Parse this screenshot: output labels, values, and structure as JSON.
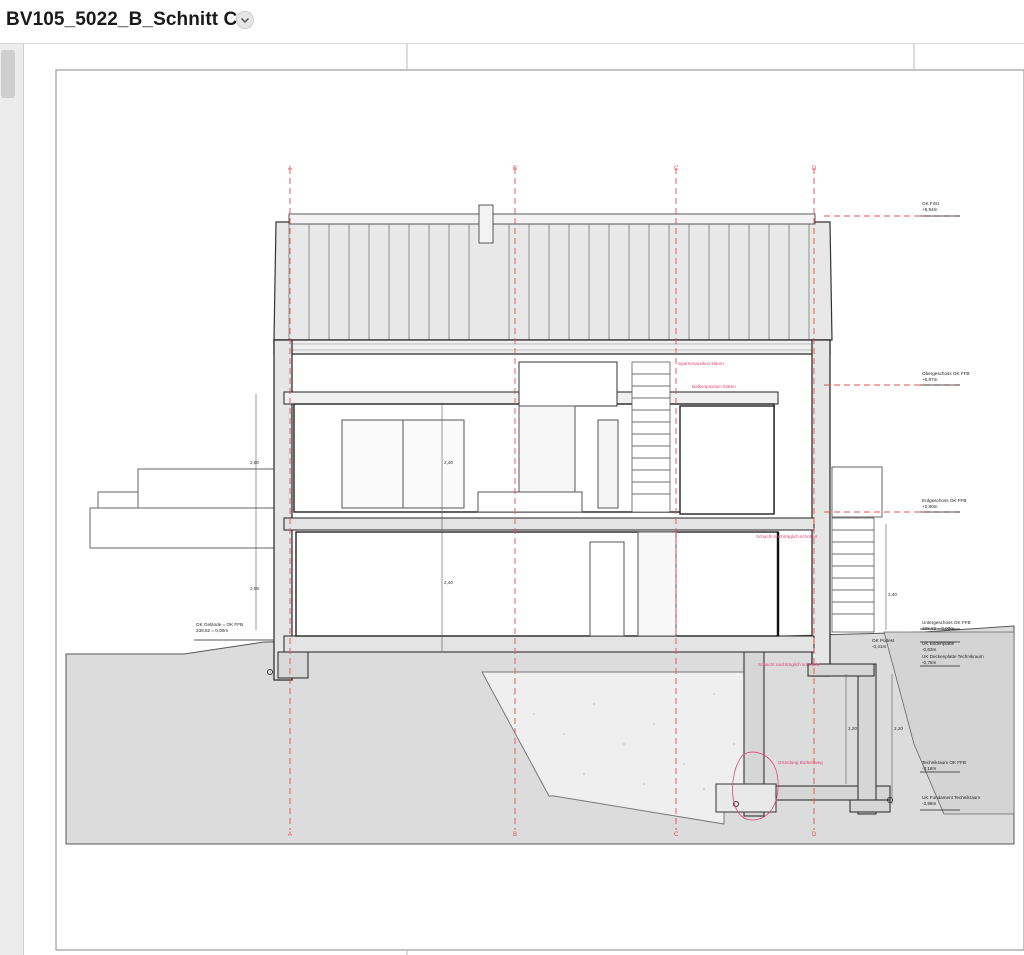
{
  "window": {
    "title": "BV105_5022_B_Schnitt CC"
  },
  "drawing": {
    "grid_axes": [
      "A",
      "B",
      "C",
      "D"
    ],
    "levels": [
      {
        "name": "OK First",
        "value": "+8,94m"
      },
      {
        "name": "Obergeschoss OK FFB",
        "value": "+6,87m"
      },
      {
        "name": "Erdgeschoss OK FFB",
        "value": "+2,80m"
      },
      {
        "name": "Untergeschoss OK FFB",
        "value": "238,62 = 0,00m"
      },
      {
        "name": "UK Bodenplatte",
        "value": "-0,63m"
      },
      {
        "name": "OK Podest",
        "value": "-0,41m"
      },
      {
        "name": "UK Deckenplatte Technikraum",
        "value": "-0,75m"
      },
      {
        "name": "Technikraum OK FFB",
        "value": "-3,18m"
      },
      {
        "name": "UK Fundament Technikraum",
        "value": "-3,98m"
      }
    ],
    "ground_label": {
      "name": "OK Gelände = OK FFB",
      "value": "238,62 = 0,00m"
    },
    "notes": [
      "Sparrenposition klären",
      "Balkonposition klären",
      "Schacht nachträglich schotten",
      "Schacht nachträglich schotten",
      "Gründung Borkenweg"
    ],
    "dims": [
      "2,40",
      "2,40",
      "2,80",
      "2,58",
      "3,40",
      "2,20",
      "2,20"
    ],
    "colors": {
      "accent": "#e0447a",
      "axis": "#e05050",
      "line": "#2a2a2a",
      "fill": "#d9d9d9"
    }
  }
}
